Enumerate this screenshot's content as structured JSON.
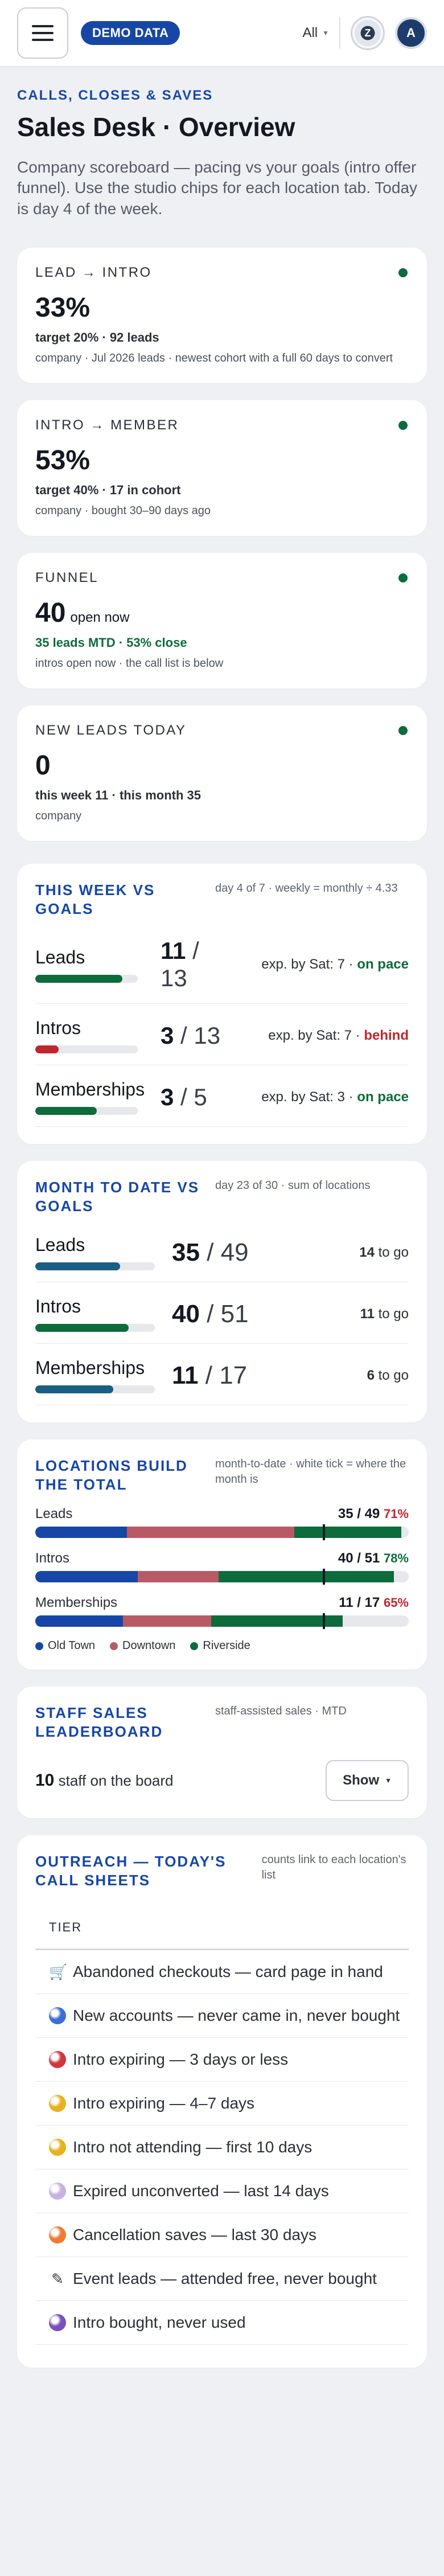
{
  "topbar": {
    "demo_badge": "DEMO DATA",
    "location_filter": "All",
    "avatar_initial": "A"
  },
  "intro": {
    "eyebrow": "CALLS, CLOSES & SAVES",
    "title": "Sales Desk · Overview",
    "description": "Company scoreboard — pacing vs your goals (intro offer funnel). Use the studio chips for each location tab. Today is day 4 of the week."
  },
  "kpis": [
    {
      "label": "LEAD → INTRO",
      "value": "33%",
      "value_suffix": "",
      "sub": "target 20% · 92 leads",
      "note": "company · Jul 2026 leads · newest cohort with a full 60 days to convert"
    },
    {
      "label": "INTRO → MEMBER",
      "value": "53%",
      "value_suffix": "",
      "sub": "target 40% · 17 in cohort",
      "note": "company · bought 30–90 days ago"
    },
    {
      "label": "FUNNEL",
      "value": "40",
      "value_suffix": "open now",
      "sub": "35 leads MTD · 53% close",
      "note": "intros open now · the call list is below"
    },
    {
      "label": "NEW LEADS TODAY",
      "value": "0",
      "value_suffix": "",
      "sub": "this week 11 · this month 35",
      "note": "company"
    }
  ],
  "week": {
    "title": "THIS WEEK VS GOALS",
    "meta": "day 4 of 7 · weekly = monthly ÷ 4.33",
    "rows": [
      {
        "name": "Leads",
        "count": "11",
        "target": "13",
        "progress": 0.85,
        "exp_text": "exp. by Sat: 7 ·",
        "status": "on pace",
        "status_kind": "ok"
      },
      {
        "name": "Intros",
        "count": "3",
        "target": "13",
        "progress": 0.23,
        "exp_text": "exp. by Sat: 7 ·",
        "status": "behind",
        "status_kind": "bad"
      },
      {
        "name": "Memberships",
        "count": "3",
        "target": "5",
        "progress": 0.6,
        "exp_text": "exp. by Sat: 3 ·",
        "status": "on pace",
        "status_kind": "ok"
      }
    ]
  },
  "mtd": {
    "title": "MONTH TO DATE VS GOALS",
    "meta": "day 23 of 30 · sum of locations",
    "rows": [
      {
        "name": "Leads",
        "count": "35",
        "target": "49",
        "progress": 0.71,
        "to_go": "14",
        "to_go_label": "to go",
        "color": "#1b5e83"
      },
      {
        "name": "Intros",
        "count": "40",
        "target": "51",
        "progress": 0.78,
        "to_go": "11",
        "to_go_label": "to go",
        "color": "#0e6b3c"
      },
      {
        "name": "Memberships",
        "count": "11",
        "target": "17",
        "progress": 0.65,
        "to_go": "6",
        "to_go_label": "to go",
        "color": "#1b5e83"
      }
    ]
  },
  "locations": {
    "title": "LOCATIONS BUILD THE TOTAL",
    "meta": "month-to-date · white tick = where the month is",
    "month_progress": 0.77,
    "rows": [
      {
        "name": "Leads",
        "value": "35 / 49",
        "pct": "71%",
        "pct_kind": "bad",
        "segments": [
          12,
          22,
          14
        ]
      },
      {
        "name": "Intros",
        "value": "40 / 51",
        "pct": "78%",
        "pct_kind": "ok",
        "segments": [
          14,
          11,
          24
        ]
      },
      {
        "name": "Memberships",
        "value": "11 / 17",
        "pct": "65%",
        "pct_kind": "bad",
        "segments": [
          4,
          4,
          6
        ]
      }
    ],
    "legend": [
      {
        "name": "Old Town",
        "color": "#1747a6"
      },
      {
        "name": "Downtown",
        "color": "#b85a66"
      },
      {
        "name": "Riverside",
        "color": "#0e6b3c"
      }
    ]
  },
  "staff": {
    "title": "STAFF SALES LEADERBOARD",
    "meta": "staff-assisted sales · MTD",
    "count": "10",
    "count_label": "staff on the board",
    "show_label": "Show"
  },
  "outreach": {
    "title": "OUTREACH — TODAY'S CALL SHEETS",
    "meta": "counts link to each location's list",
    "tier_header": "TIER",
    "tiers": [
      {
        "icon": "cart-icon",
        "label": "Abandoned checkouts — card page in hand"
      },
      {
        "icon": "blue-circle-icon",
        "color": "#3b6fd6",
        "label": "New accounts — never came in, never bought"
      },
      {
        "icon": "red-circle-icon",
        "color": "#d2363d",
        "label": "Intro expiring — 3 days or less"
      },
      {
        "icon": "yellow-circle-icon",
        "color": "#e7b21c",
        "label": "Intro expiring — 4–7 days"
      },
      {
        "icon": "yellow-circle-icon",
        "color": "#e7b21c",
        "label": "Intro not attending — first 10 days"
      },
      {
        "icon": "lavender-circle-icon",
        "color": "#c7b1e6",
        "label": "Expired unconverted — last 14 days"
      },
      {
        "icon": "orange-circle-icon",
        "color": "#ef7b32",
        "label": "Cancellation saves — last 30 days"
      },
      {
        "icon": "ticket-icon",
        "label": "Event leads — attended free, never bought"
      },
      {
        "icon": "purple-circle-icon",
        "color": "#7a4fbf",
        "label": "Intro bought, never used"
      }
    ]
  }
}
